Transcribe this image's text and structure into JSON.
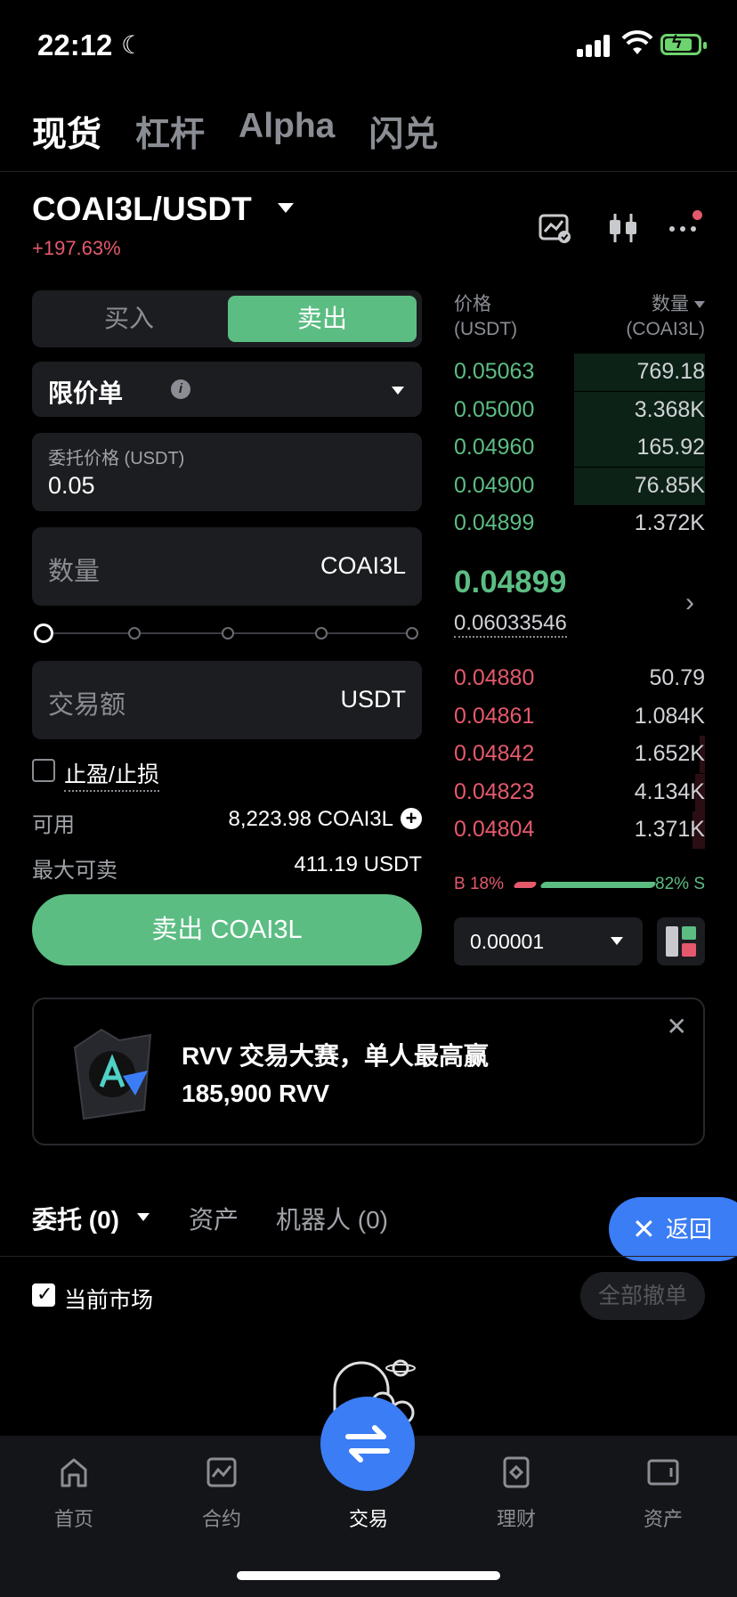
{
  "status": {
    "time": "22:12"
  },
  "top_tabs": [
    "现货",
    "杠杆",
    "Alpha",
    "闪兑"
  ],
  "pair": {
    "symbol": "COAI3L/USDT",
    "change": "+197.63%"
  },
  "form": {
    "buy_label": "买入",
    "sell_label": "卖出",
    "order_type": "限价单",
    "price_label": "委托价格 (USDT)",
    "price_value": "0.05",
    "qty_label": "数量",
    "qty_unit": "COAI3L",
    "amount_label": "交易额",
    "amount_unit": "USDT",
    "tpsl_label": "止盈/止损",
    "available_label": "可用",
    "available_value": "8,223.98 COAI3L",
    "max_sell_label": "最大可卖",
    "max_sell_value": "411.19 USDT",
    "submit_label": "卖出 COAI3L"
  },
  "orderbook": {
    "price_header": "价格",
    "price_unit": "(USDT)",
    "qty_header": "数量",
    "qty_unit": "(COAI3L)",
    "asks": [
      {
        "price": "0.05063",
        "qty": "769.18",
        "depth": 0.52
      },
      {
        "price": "0.05000",
        "qty": "3.368K",
        "depth": 0.52
      },
      {
        "price": "0.04960",
        "qty": "165.92",
        "depth": 0.52
      },
      {
        "price": "0.04900",
        "qty": "76.85K",
        "depth": 0.52
      },
      {
        "price": "0.04899",
        "qty": "1.372K",
        "depth": 0
      }
    ],
    "last_price": "0.04899",
    "mark_price": "0.06033546",
    "bids": [
      {
        "price": "0.04880",
        "qty": "50.79",
        "depth": 0
      },
      {
        "price": "0.04861",
        "qty": "1.084K",
        "depth": 0
      },
      {
        "price": "0.04842",
        "qty": "1.652K",
        "depth": 0.02
      },
      {
        "price": "0.04823",
        "qty": "4.134K",
        "depth": 0.04
      },
      {
        "price": "0.04804",
        "qty": "1.371K",
        "depth": 0.05
      }
    ],
    "buy_ratio_label": "B 18%",
    "sell_ratio_label": "82% S",
    "buy_ratio": 0.18,
    "precision": "0.00001"
  },
  "banner": {
    "line1": "RVV 交易大赛，单人最高赢",
    "line2": "185,900 RVV"
  },
  "bottom_tabs": {
    "orders": "委托 (0)",
    "assets": "资产",
    "bots": "机器人 (0)",
    "back": "返回",
    "current_market": "当前市场",
    "cancel_all": "全部撤单"
  },
  "nav": [
    "首页",
    "合约",
    "交易",
    "理财",
    "资产"
  ],
  "colors": {
    "green": "#5cbd83",
    "red": "#e5596c",
    "blue": "#3b7df5"
  }
}
